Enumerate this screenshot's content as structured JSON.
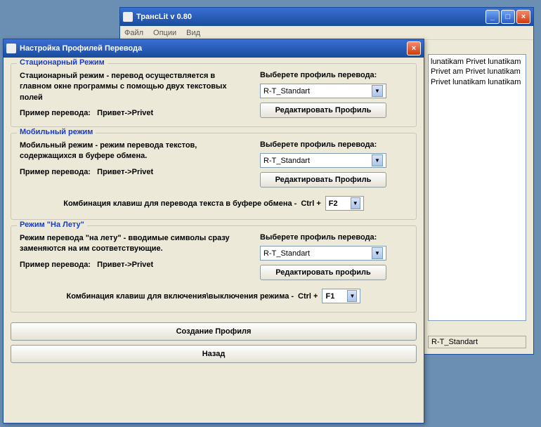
{
  "mainWindow": {
    "title": "ТрансLit v 0.80",
    "menu": {
      "file": "Файл",
      "options": "Опции",
      "view": "Вид"
    },
    "textArea": "lunatikam Privet lunatikam Privet\nam Privet lunatikam Privet lunatikam\nlunatikam",
    "statusProfile": "R-T_Standart"
  },
  "dialog": {
    "title": "Настройка Профилей Перевода",
    "stationary": {
      "groupTitle": "Стационарный Режим",
      "desc": "Стационарный режим - перевод осуществляется в главном окне программы с помощью двух текстовых полей",
      "exampleLabel": "Пример перевода:",
      "exampleValue": "Привет->Privet",
      "selectLabel": "Выберете профиль перевода:",
      "selectValue": "R-T_Standart",
      "editBtn": "Редактировать Профиль"
    },
    "mobile": {
      "groupTitle": "Мобильный режим",
      "desc": "Мобильный режим - режим перевода текстов, содержащихся в буфере обмена.",
      "exampleLabel": "Пример перевода:",
      "exampleValue": "Привет->Privet",
      "selectLabel": "Выберете профиль перевода:",
      "selectValue": "R-T_Standart",
      "editBtn": "Редактировать Профиль",
      "hotkeyLabel": "Комбинация клавиш для перевода текста в буфере обмена -",
      "ctrl": "Ctrl +",
      "hotkeyValue": "F2"
    },
    "fly": {
      "groupTitle": "Режим \"На Лету\"",
      "desc": "Режим перевода \"на лету\" - вводимые символы сразу заменяются на им соответствующие.",
      "exampleLabel": "Пример перевода:",
      "exampleValue": "Привет->Privet",
      "selectLabel": "Выберете профиль перевода:",
      "selectValue": "R-T_Standart",
      "editBtn": "Редактировать профиль",
      "hotkeyLabel": "Комбинация клавиш для включения\\выключения режима -",
      "ctrl": "Ctrl +",
      "hotkeyValue": "F1"
    },
    "createBtn": "Создание Профиля",
    "backBtn": "Назад"
  }
}
